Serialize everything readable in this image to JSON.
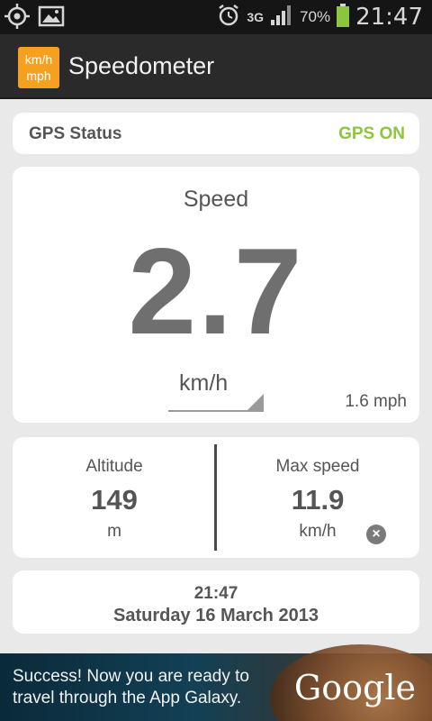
{
  "status_bar": {
    "time": "21:47",
    "battery_percent": "70%",
    "network": "3G",
    "icons": [
      "gps-icon",
      "gallery-icon",
      "alarm-icon",
      "signal-icon",
      "battery-icon"
    ]
  },
  "app": {
    "title": "Speedometer",
    "icon_top": "km/h",
    "icon_bottom": "mph"
  },
  "gps": {
    "label": "GPS Status",
    "value": "GPS ON"
  },
  "speed": {
    "title": "Speed",
    "value": "2.7",
    "unit": "km/h",
    "alt_value": "1.6 mph"
  },
  "altitude": {
    "label": "Altitude",
    "value": "149",
    "unit": "m"
  },
  "max_speed": {
    "label": "Max speed",
    "value": "11.9",
    "unit": "km/h"
  },
  "datetime": {
    "time": "21:47",
    "date": "Saturday 16 March 2013"
  },
  "ad": {
    "text": "Success! Now you are ready to travel through the App Galaxy.",
    "brand": "Google"
  },
  "colors": {
    "accent_orange": "#f5a01e",
    "gps_on_green": "#8cc63f",
    "battery_green": "#8cc63f"
  }
}
